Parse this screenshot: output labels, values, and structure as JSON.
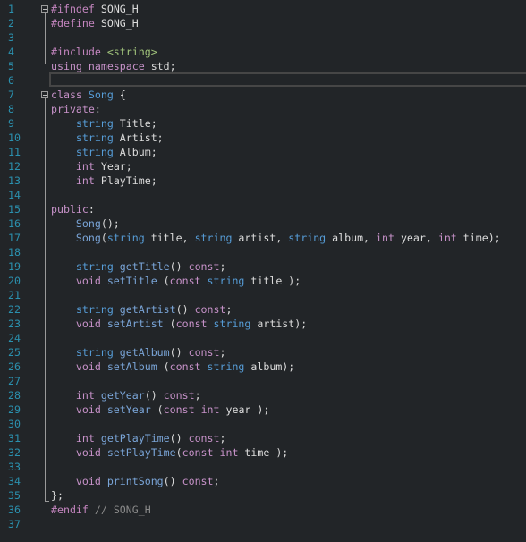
{
  "editor": {
    "language": "cpp",
    "current_line": 6,
    "colors": {
      "background": "#222528",
      "line_number": "#2b91af",
      "preprocessor": "#c586c0",
      "keyword": "#c792c9",
      "type": "#569cd6",
      "function": "#7aa5d8",
      "identifier": "#dcdcdc",
      "include_path": "#a2c57c",
      "comment": "#8a8a8a"
    },
    "line_numbers": [
      "1",
      "2",
      "3",
      "4",
      "5",
      "6",
      "7",
      "8",
      "9",
      "10",
      "11",
      "12",
      "13",
      "14",
      "15",
      "16",
      "17",
      "18",
      "19",
      "20",
      "21",
      "22",
      "23",
      "24",
      "25",
      "26",
      "27",
      "28",
      "29",
      "30",
      "31",
      "32",
      "33",
      "34",
      "35",
      "36",
      "37"
    ],
    "lines": [
      [
        {
          "t": "pp",
          "v": "#ifndef"
        },
        {
          "t": "id",
          "v": " SONG_H"
        }
      ],
      [
        {
          "t": "pp",
          "v": "#define"
        },
        {
          "t": "id",
          "v": " SONG_H"
        }
      ],
      [],
      [
        {
          "t": "pp",
          "v": "#include"
        },
        {
          "t": "id",
          "v": " "
        },
        {
          "t": "inc",
          "v": "<string>"
        }
      ],
      [
        {
          "t": "kw",
          "v": "using"
        },
        {
          "t": "id",
          "v": " "
        },
        {
          "t": "kw",
          "v": "namespace"
        },
        {
          "t": "id",
          "v": " std;"
        }
      ],
      [],
      [
        {
          "t": "kw",
          "v": "class"
        },
        {
          "t": "id",
          "v": " "
        },
        {
          "t": "ty",
          "v": "Song"
        },
        {
          "t": "id",
          "v": " {"
        }
      ],
      [
        {
          "t": "lbl",
          "v": "private"
        },
        {
          "t": "id",
          "v": ":"
        }
      ],
      [
        {
          "t": "id",
          "v": "    "
        },
        {
          "t": "ty",
          "v": "string"
        },
        {
          "t": "id",
          "v": " Title;"
        }
      ],
      [
        {
          "t": "id",
          "v": "    "
        },
        {
          "t": "ty",
          "v": "string"
        },
        {
          "t": "id",
          "v": " Artist;"
        }
      ],
      [
        {
          "t": "id",
          "v": "    "
        },
        {
          "t": "ty",
          "v": "string"
        },
        {
          "t": "id",
          "v": " Album;"
        }
      ],
      [
        {
          "t": "id",
          "v": "    "
        },
        {
          "t": "kw",
          "v": "int"
        },
        {
          "t": "id",
          "v": " Year;"
        }
      ],
      [
        {
          "t": "id",
          "v": "    "
        },
        {
          "t": "kw",
          "v": "int"
        },
        {
          "t": "id",
          "v": " PlayTime;"
        }
      ],
      [],
      [
        {
          "t": "lbl",
          "v": "public"
        },
        {
          "t": "id",
          "v": ":"
        }
      ],
      [
        {
          "t": "id",
          "v": "    "
        },
        {
          "t": "fn",
          "v": "Song"
        },
        {
          "t": "id",
          "v": "();"
        }
      ],
      [
        {
          "t": "id",
          "v": "    "
        },
        {
          "t": "fn",
          "v": "Song"
        },
        {
          "t": "id",
          "v": "("
        },
        {
          "t": "ty",
          "v": "string"
        },
        {
          "t": "id",
          "v": " title, "
        },
        {
          "t": "ty",
          "v": "string"
        },
        {
          "t": "id",
          "v": " artist, "
        },
        {
          "t": "ty",
          "v": "string"
        },
        {
          "t": "id",
          "v": " album, "
        },
        {
          "t": "kw",
          "v": "int"
        },
        {
          "t": "id",
          "v": " year, "
        },
        {
          "t": "kw",
          "v": "int"
        },
        {
          "t": "id",
          "v": " time);"
        }
      ],
      [],
      [
        {
          "t": "id",
          "v": "    "
        },
        {
          "t": "ty",
          "v": "string"
        },
        {
          "t": "id",
          "v": " "
        },
        {
          "t": "fn",
          "v": "getTitle"
        },
        {
          "t": "id",
          "v": "() "
        },
        {
          "t": "kw",
          "v": "const"
        },
        {
          "t": "id",
          "v": ";"
        }
      ],
      [
        {
          "t": "id",
          "v": "    "
        },
        {
          "t": "kw",
          "v": "void"
        },
        {
          "t": "id",
          "v": " "
        },
        {
          "t": "fn",
          "v": "setTitle"
        },
        {
          "t": "id",
          "v": " ("
        },
        {
          "t": "kw",
          "v": "const"
        },
        {
          "t": "id",
          "v": " "
        },
        {
          "t": "ty",
          "v": "string"
        },
        {
          "t": "id",
          "v": " title );"
        }
      ],
      [],
      [
        {
          "t": "id",
          "v": "    "
        },
        {
          "t": "ty",
          "v": "string"
        },
        {
          "t": "id",
          "v": " "
        },
        {
          "t": "fn",
          "v": "getArtist"
        },
        {
          "t": "id",
          "v": "() "
        },
        {
          "t": "kw",
          "v": "const"
        },
        {
          "t": "id",
          "v": ";"
        }
      ],
      [
        {
          "t": "id",
          "v": "    "
        },
        {
          "t": "kw",
          "v": "void"
        },
        {
          "t": "id",
          "v": " "
        },
        {
          "t": "fn",
          "v": "setArtist"
        },
        {
          "t": "id",
          "v": " ("
        },
        {
          "t": "kw",
          "v": "const"
        },
        {
          "t": "id",
          "v": " "
        },
        {
          "t": "ty",
          "v": "string"
        },
        {
          "t": "id",
          "v": " artist);"
        }
      ],
      [],
      [
        {
          "t": "id",
          "v": "    "
        },
        {
          "t": "ty",
          "v": "string"
        },
        {
          "t": "id",
          "v": " "
        },
        {
          "t": "fn",
          "v": "getAlbum"
        },
        {
          "t": "id",
          "v": "() "
        },
        {
          "t": "kw",
          "v": "const"
        },
        {
          "t": "id",
          "v": ";"
        }
      ],
      [
        {
          "t": "id",
          "v": "    "
        },
        {
          "t": "kw",
          "v": "void"
        },
        {
          "t": "id",
          "v": " "
        },
        {
          "t": "fn",
          "v": "setAlbum"
        },
        {
          "t": "id",
          "v": " ("
        },
        {
          "t": "kw",
          "v": "const"
        },
        {
          "t": "id",
          "v": " "
        },
        {
          "t": "ty",
          "v": "string"
        },
        {
          "t": "id",
          "v": " album);"
        }
      ],
      [],
      [
        {
          "t": "id",
          "v": "    "
        },
        {
          "t": "kw",
          "v": "int"
        },
        {
          "t": "id",
          "v": " "
        },
        {
          "t": "fn",
          "v": "getYear"
        },
        {
          "t": "id",
          "v": "() "
        },
        {
          "t": "kw",
          "v": "const"
        },
        {
          "t": "id",
          "v": ";"
        }
      ],
      [
        {
          "t": "id",
          "v": "    "
        },
        {
          "t": "kw",
          "v": "void"
        },
        {
          "t": "id",
          "v": " "
        },
        {
          "t": "fn",
          "v": "setYear"
        },
        {
          "t": "id",
          "v": " ("
        },
        {
          "t": "kw",
          "v": "const"
        },
        {
          "t": "id",
          "v": " "
        },
        {
          "t": "kw",
          "v": "int"
        },
        {
          "t": "id",
          "v": " year );"
        }
      ],
      [],
      [
        {
          "t": "id",
          "v": "    "
        },
        {
          "t": "kw",
          "v": "int"
        },
        {
          "t": "id",
          "v": " "
        },
        {
          "t": "fn",
          "v": "getPlayTime"
        },
        {
          "t": "id",
          "v": "() "
        },
        {
          "t": "kw",
          "v": "const"
        },
        {
          "t": "id",
          "v": ";"
        }
      ],
      [
        {
          "t": "id",
          "v": "    "
        },
        {
          "t": "kw",
          "v": "void"
        },
        {
          "t": "id",
          "v": " "
        },
        {
          "t": "fn",
          "v": "setPlayTime"
        },
        {
          "t": "id",
          "v": "("
        },
        {
          "t": "kw",
          "v": "const"
        },
        {
          "t": "id",
          "v": " "
        },
        {
          "t": "kw",
          "v": "int"
        },
        {
          "t": "id",
          "v": " time );"
        }
      ],
      [],
      [
        {
          "t": "id",
          "v": "    "
        },
        {
          "t": "kw",
          "v": "void"
        },
        {
          "t": "id",
          "v": " "
        },
        {
          "t": "fn",
          "v": "printSong"
        },
        {
          "t": "id",
          "v": "() "
        },
        {
          "t": "kw",
          "v": "const"
        },
        {
          "t": "id",
          "v": ";"
        }
      ],
      [
        {
          "t": "id",
          "v": "};"
        }
      ],
      [
        {
          "t": "pp",
          "v": "#endif"
        },
        {
          "t": "id",
          "v": " "
        },
        {
          "t": "com",
          "v": "// SONG_H"
        }
      ],
      []
    ]
  }
}
